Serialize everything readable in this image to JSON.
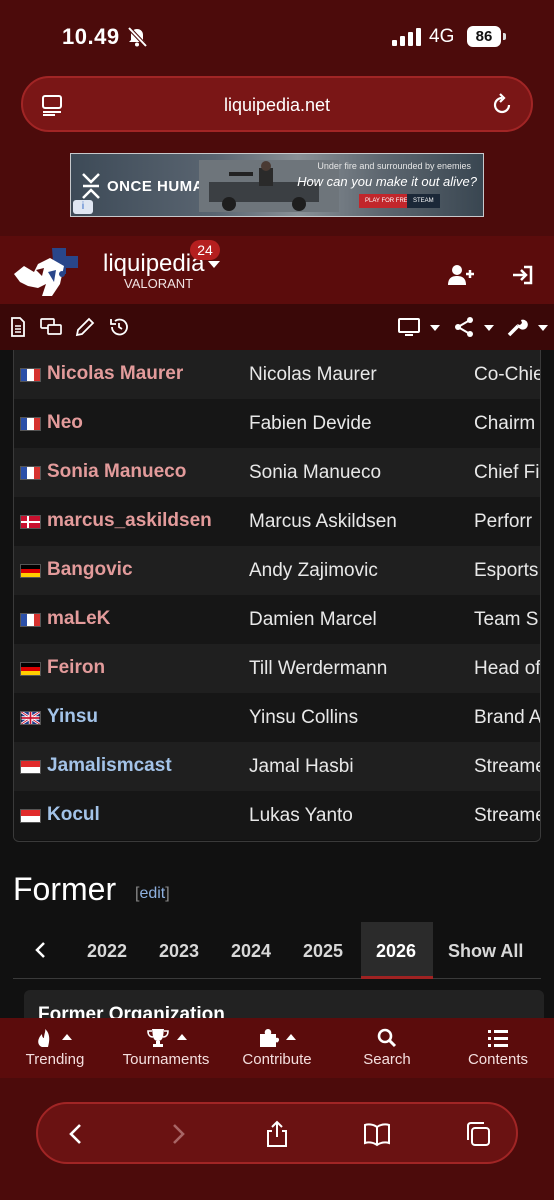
{
  "status_bar": {
    "time": "10.49",
    "network": "4G",
    "battery": "86"
  },
  "browser": {
    "url": "liquipedia.net"
  },
  "ad": {
    "brand": "ONCE HUMAN",
    "tagline_top": "Under fire and surrounded by enemies",
    "tagline_main": "How can you make it out alive?",
    "button_play": "PLAY FOR FREE",
    "button_store": "STEAM",
    "info_label": "i"
  },
  "site": {
    "name": "liquipedia",
    "wiki": "VALORANT",
    "notification_count": "24"
  },
  "icons": {
    "tools": [
      "page-icon",
      "discussion-icon",
      "edit-pencil-icon",
      "history-icon",
      "monitor-icon",
      "share-icon",
      "wrench-icon"
    ],
    "header": [
      "add-user-icon",
      "login-icon"
    ]
  },
  "staff_rows": [
    {
      "flag": "fr",
      "id": "Nicolas Maurer",
      "name": "Nicolas Maurer",
      "position": "Co-Chie",
      "id_color": "red"
    },
    {
      "flag": "fr",
      "id": "Neo",
      "name": "Fabien Devide",
      "position": "Chairm",
      "id_color": "red"
    },
    {
      "flag": "fr",
      "id": "Sonia Manueco",
      "name": "Sonia Manueco",
      "position": "Chief Fi",
      "id_color": "red"
    },
    {
      "flag": "dk",
      "id": "marcus_askildsen",
      "name": "Marcus Askildsen",
      "position": "Perforr",
      "id_color": "red"
    },
    {
      "flag": "de",
      "id": "Bangovic",
      "name": "Andy Zajimovic",
      "position": "Esports",
      "id_color": "red"
    },
    {
      "flag": "fr",
      "id": "maLeK",
      "name": "Damien Marcel",
      "position": "Team S",
      "id_color": "red"
    },
    {
      "flag": "de",
      "id": "Feiron",
      "name": "Till Werdermann",
      "position": "Head of",
      "id_color": "red"
    },
    {
      "flag": "gb",
      "id": "Yinsu",
      "name": "Yinsu Collins",
      "position": "Brand A",
      "id_color": "blue"
    },
    {
      "flag": "id",
      "id": "Jamalismcast",
      "name": "Jamal Hasbi",
      "position": "Streame",
      "id_color": "blue"
    },
    {
      "flag": "id",
      "id": "Kocul",
      "name": "Lukas Yanto",
      "position": "Streame",
      "id_color": "blue"
    }
  ],
  "former": {
    "heading": "Former",
    "edit_open": "[",
    "edit_label": "edit",
    "edit_close": "]",
    "tabs": [
      "2022",
      "2023",
      "2024",
      "2025",
      "2026",
      "Show All"
    ],
    "active_tab": "2026",
    "box_title": "Former Organization"
  },
  "bottom_nav": [
    {
      "label": "Trending",
      "icon": "fire-icon"
    },
    {
      "label": "Tournaments",
      "icon": "trophy-icon"
    },
    {
      "label": "Contribute",
      "icon": "puzzle-icon"
    },
    {
      "label": "Search",
      "icon": "search-icon"
    },
    {
      "label": "Contents",
      "icon": "list-icon"
    }
  ],
  "colors": {
    "header_red": "#5b0c0c",
    "player_link": "#e39b9b",
    "blue_link": "#a3c3e8",
    "active_tab_border": "#a02222"
  }
}
